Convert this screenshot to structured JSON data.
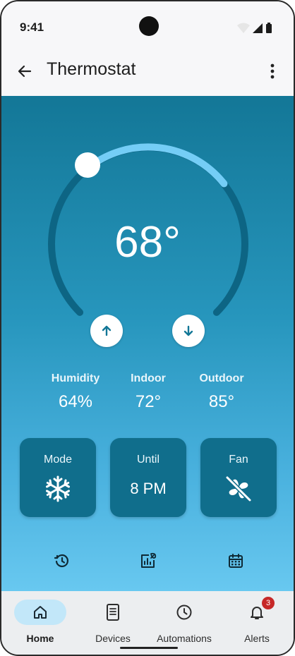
{
  "status_bar": {
    "time": "9:41",
    "icons": [
      "wifi-icon",
      "cellular-icon",
      "battery-icon"
    ]
  },
  "app_bar": {
    "title": "Thermostat",
    "back_icon": "arrow-left-icon",
    "menu_icon": "more-vert-icon"
  },
  "thermostat": {
    "setpoint": "68°",
    "controls": {
      "up_icon": "arrow-up-icon",
      "down_icon": "arrow-down-icon"
    },
    "colors": {
      "track": "#0d6584",
      "active_arc": "#74cdf6",
      "knob": "#ffffff"
    }
  },
  "stats": [
    {
      "label": "Humidity",
      "value": "64%"
    },
    {
      "label": "Indoor",
      "value": "72°"
    },
    {
      "label": "Outdoor",
      "value": "85°"
    }
  ],
  "tiles": {
    "mode": {
      "label": "Mode",
      "icon": "snowflake-icon"
    },
    "until": {
      "label": "Until",
      "value": "8 PM"
    },
    "fan": {
      "label": "Fan",
      "icon": "fan-off-icon"
    }
  },
  "tools": [
    "history-icon",
    "energy-report-icon",
    "schedule-calendar-icon"
  ],
  "bottom_nav": {
    "items": [
      {
        "label": "Home",
        "icon": "home-icon",
        "active": true
      },
      {
        "label": "Devices",
        "icon": "devices-icon",
        "active": false
      },
      {
        "label": "Automations",
        "icon": "clock-icon",
        "active": false
      },
      {
        "label": "Alerts",
        "icon": "bell-icon",
        "active": false,
        "badge": "3"
      }
    ]
  },
  "colors": {
    "gradient_top": "#137797",
    "gradient_bottom": "#68c8f0",
    "tile_bg": "#106e8c",
    "nav_active_pill": "#c2e7f9",
    "badge": "#c62828"
  }
}
